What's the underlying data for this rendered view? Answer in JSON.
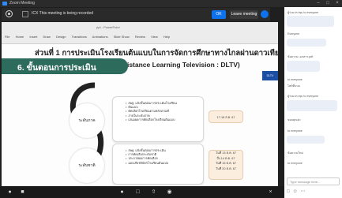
{
  "window": {
    "title": "Zoom Meeting"
  },
  "banner": {
    "text": "ICX This meeting is being recorded",
    "ok_label": "OK",
    "leave_label": "Leave meeting"
  },
  "ppt": {
    "doc_title": "ppt - PowerPoint",
    "tabs": [
      "File",
      "Home",
      "Insert",
      "Draw",
      "Design",
      "Transitions",
      "Animations",
      "Slide Show",
      "Review",
      "View",
      "Help"
    ]
  },
  "slide": {
    "header": "ส่วนที่ 1 การประเมินโรงเรียนต้นแบบในการจัดการศึกษาทางไกลผ่านดาวเทียม",
    "subheader": "(Distance Learning Television : DLTV)",
    "step_title": "6. ขั้นตอนการประเมิน",
    "badge": "DLTV",
    "levels": [
      {
        "name": "ระดับภาค",
        "bullets": [
          "สพฐ. แจ้งขั้นตอนการประเมินโรงเรียน",
          "ต้นแบบ",
          "คัดเลือกโรงเรียนตามหลักเกณฑ์",
          "ภายในระดับภาค",
          "เสนอผลการคัดเลือกโรงเรียนต้นแบบ"
        ],
        "dates": [
          "17-18 ส.ค. 67"
        ]
      },
      {
        "name": "ระดับชาติ",
        "bullets": [
          "สพฐ. แจ้งขั้นตอนการประเมิน",
          "การคัดเลือกระดับชาติ",
          "ประกาศผลการคัดเลือก",
          "มอบเกียรติบัตรโรงเรียนต้นแบบ"
        ],
        "dates": [
          "วันที่ 13 ต.ค. 67",
          "ถึง 14 ต.ค. 67",
          "วันที่ 15 ต.ค. 67",
          "วันที่ 20 ต.ค. 67"
        ]
      }
    ]
  },
  "chat": {
    "messages": [
      "ผู้ร่วมประชุม to everyone",
      "Everyone",
      "ข้อความ เอกสาร.pdf",
      "to everyone",
      "ไฟล์ที่แนบ",
      "ผู้ร่วมประชุม to everyone",
      "ขอบคุณค่ะ",
      "to everyone",
      "ข้อความใหม่",
      "to everyone"
    ],
    "input_placeholder": "Type message here..."
  },
  "colors": {
    "accent": "#0e72ed",
    "step_green": "#2d6b5d",
    "date_fill": "#fbeede"
  }
}
